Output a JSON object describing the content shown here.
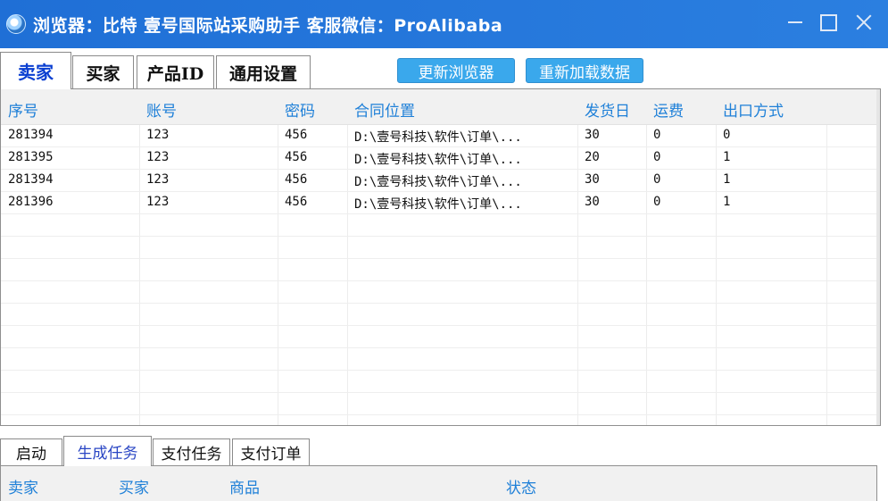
{
  "window": {
    "title": "浏览器：比特 壹号国际站采购助手 客服微信：ProAlibaba"
  },
  "main_tabs": [
    {
      "label": "卖家",
      "active": true
    },
    {
      "label": "买家",
      "active": false
    },
    {
      "label": "产品ID",
      "active": false
    },
    {
      "label": "通用设置",
      "active": false
    }
  ],
  "toolbar": {
    "update_browser_label": "更新浏览器",
    "reload_data_label": "重新加载数据"
  },
  "grid": {
    "columns": [
      "序号",
      "账号",
      "密码",
      "合同位置",
      "发货日",
      "运费",
      "出口方式"
    ],
    "rows": [
      [
        "281394",
        "123",
        "456",
        "D:\\壹号科技\\软件\\订单\\...",
        "30",
        "0",
        "0"
      ],
      [
        "281395",
        "123",
        "456",
        "D:\\壹号科技\\软件\\订单\\...",
        "20",
        "0",
        "1"
      ],
      [
        "281394",
        "123",
        "456",
        "D:\\壹号科技\\软件\\订单\\...",
        "30",
        "0",
        "1"
      ],
      [
        "281396",
        "123",
        "456",
        "D:\\壹号科技\\软件\\订单\\...",
        "30",
        "0",
        "1"
      ]
    ]
  },
  "bottom_tabs": [
    {
      "label": "启动",
      "active": false
    },
    {
      "label": "生成任务",
      "active": true
    },
    {
      "label": "支付任务",
      "active": false
    },
    {
      "label": "支付订单",
      "active": false
    }
  ],
  "bottom_grid": {
    "columns": [
      "卖家",
      "买家",
      "商品",
      "状态"
    ]
  },
  "colors": {
    "titlebar": "#2b7fe0",
    "header_text": "#1f80d8",
    "active_tab_text": "#0a3fd1",
    "button_bg": "#3aa8ec"
  }
}
